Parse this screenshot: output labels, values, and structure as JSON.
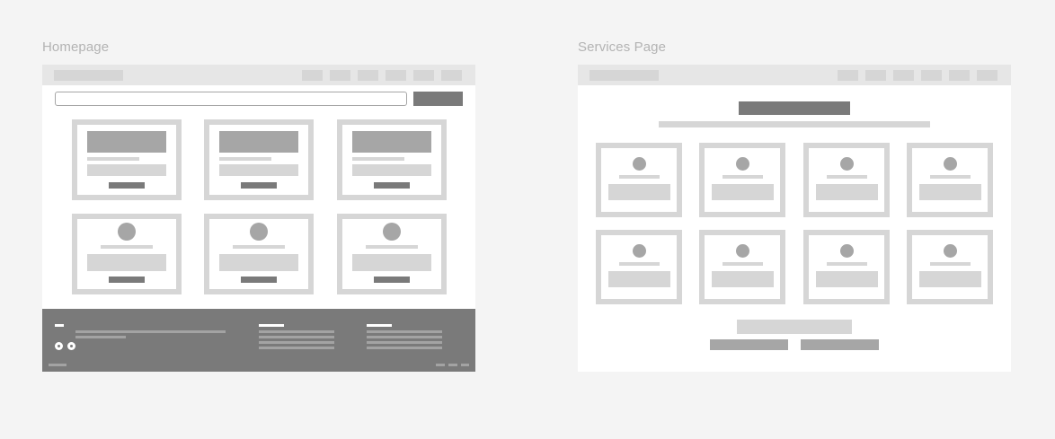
{
  "frames": [
    {
      "label": "Homepage"
    },
    {
      "label": "Services Page"
    }
  ],
  "colors": {
    "canvas": "#f4f4f4",
    "frame_background": "#ffffff",
    "nav_bar": "#e6e6e6",
    "placeholder_light": "#d6d6d6",
    "placeholder_mid": "#a6a6a6",
    "placeholder_dark": "#7a7a7a",
    "label_text": "#b3b3b3"
  }
}
